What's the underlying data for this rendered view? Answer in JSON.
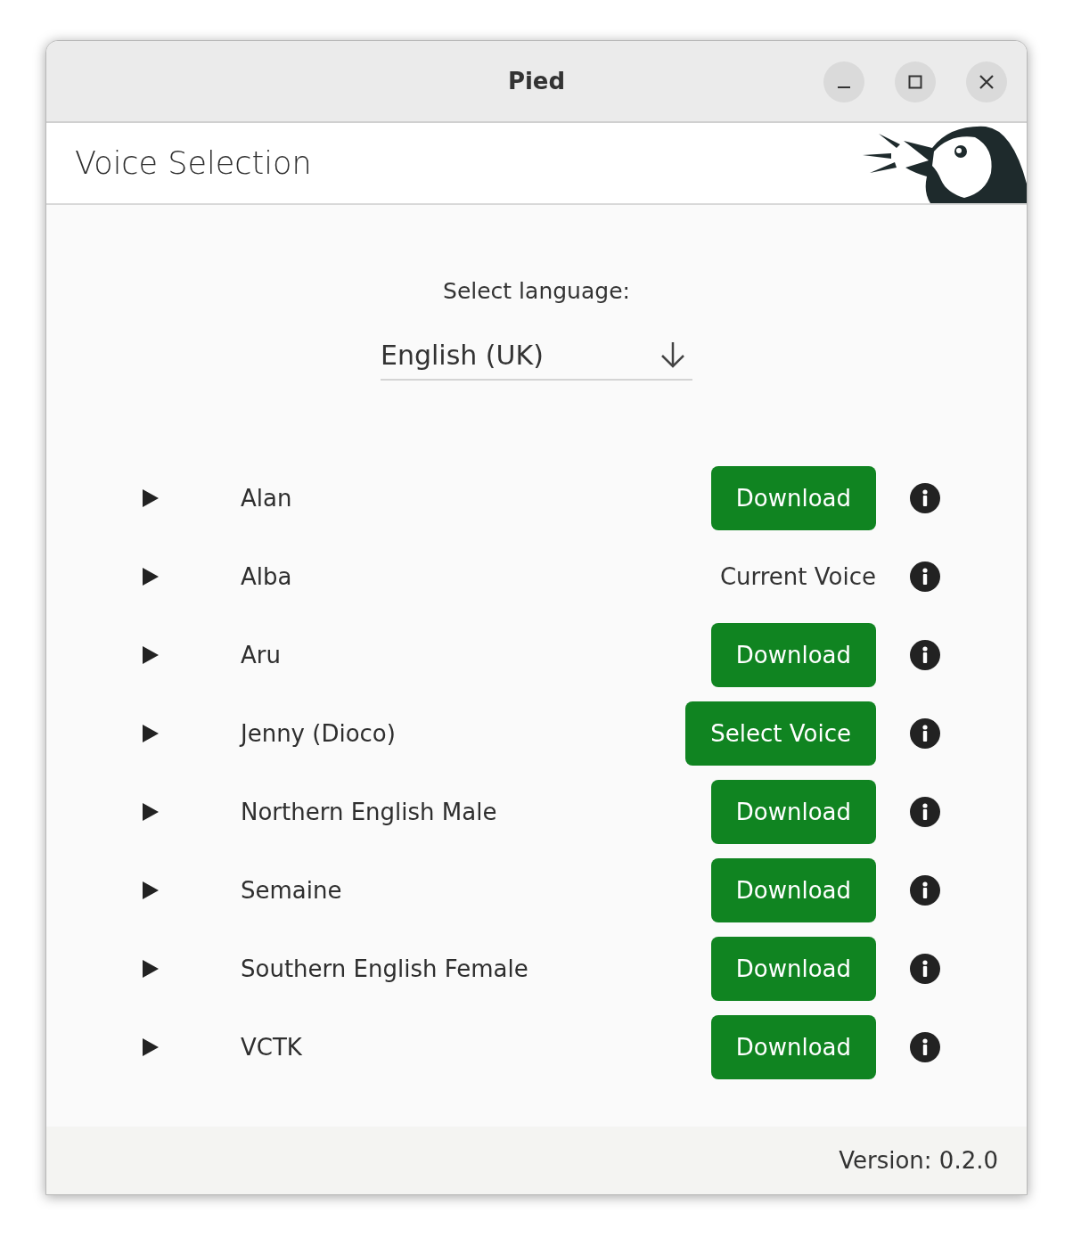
{
  "window": {
    "title": "Pied"
  },
  "header": {
    "title": "Voice Selection"
  },
  "language": {
    "label": "Select language:",
    "value": "English (UK)"
  },
  "voices": [
    {
      "name": "Alan",
      "kind": "button",
      "action": "Download"
    },
    {
      "name": "Alba",
      "kind": "status",
      "action": "Current Voice"
    },
    {
      "name": "Aru",
      "kind": "button",
      "action": "Download"
    },
    {
      "name": "Jenny (Dioco)",
      "kind": "button",
      "action": "Select Voice"
    },
    {
      "name": "Northern English Male",
      "kind": "button",
      "action": "Download"
    },
    {
      "name": "Semaine",
      "kind": "button",
      "action": "Download"
    },
    {
      "name": "Southern English Female",
      "kind": "button",
      "action": "Download"
    },
    {
      "name": "VCTK",
      "kind": "button",
      "action": "Download"
    }
  ],
  "footer": {
    "version": "Version: 0.2.0"
  }
}
